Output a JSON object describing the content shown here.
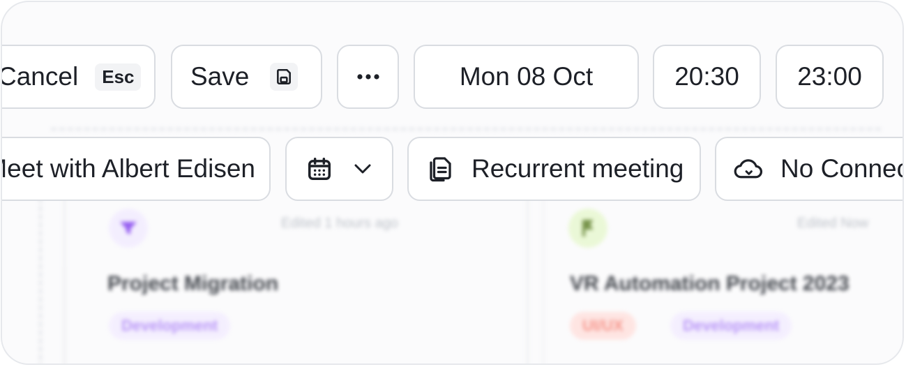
{
  "toolbar": {
    "cancel_label": "Cancel",
    "cancel_shortcut": "Esc",
    "save_label": "Save",
    "date": "Mon 08 Oct",
    "start_time": "20:30",
    "end_time": "23:00"
  },
  "event": {
    "title": "Meet with Albert Edisen",
    "recurrence_label": "Recurrent meeting",
    "connection_label": "No Connection"
  },
  "board": {
    "cards": [
      {
        "edited": "Edited 1 hours ago",
        "title": "Project Migration",
        "tags": [
          "Development"
        ]
      },
      {
        "edited": "Edited Now",
        "title": "VR Automation Project 2023",
        "tags": [
          "UI/UX",
          "Development"
        ]
      }
    ]
  },
  "colors": {
    "border": "#d9dce1",
    "text": "#1d2027",
    "purple": "#8b4ef0",
    "green": "#e6f7cf",
    "red_tag": "#ffe3e0"
  },
  "icons": {
    "save": "floppy-disk-icon",
    "more": "ellipsis-icon",
    "calendar": "calendar-icon",
    "chevron": "chevron-down-icon",
    "copy": "documents-icon",
    "cloud": "cloud-icon"
  }
}
